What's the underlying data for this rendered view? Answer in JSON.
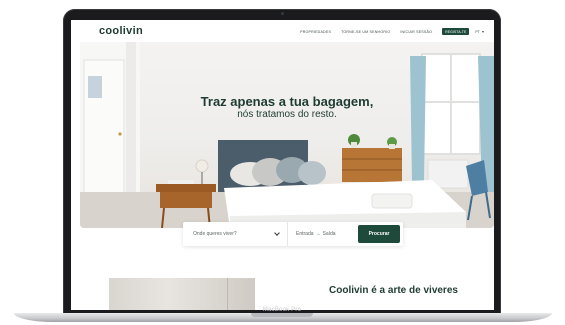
{
  "device": {
    "base_label": "MacBook Pro"
  },
  "nav": {
    "logo": "coolivin",
    "links": [
      "PROPRIEDADES",
      "TORNE-SE UM SENHORIO",
      "INICIAR SESSÃO"
    ],
    "signup_label": "REGISTA-TE",
    "language": "PT"
  },
  "hero": {
    "title": "Traz apenas a tua bagagem,",
    "subtitle": "nós tratamos do resto."
  },
  "search": {
    "where_placeholder": "Onde queres viver?",
    "checkin": "Entrada",
    "arrow": "→",
    "checkout": "Saída",
    "button_label": "Procurar"
  },
  "section": {
    "title": "Coolivin é a arte de viveres"
  },
  "colors": {
    "brand": "#1e4a3b",
    "text_dark": "#1f3b33"
  }
}
